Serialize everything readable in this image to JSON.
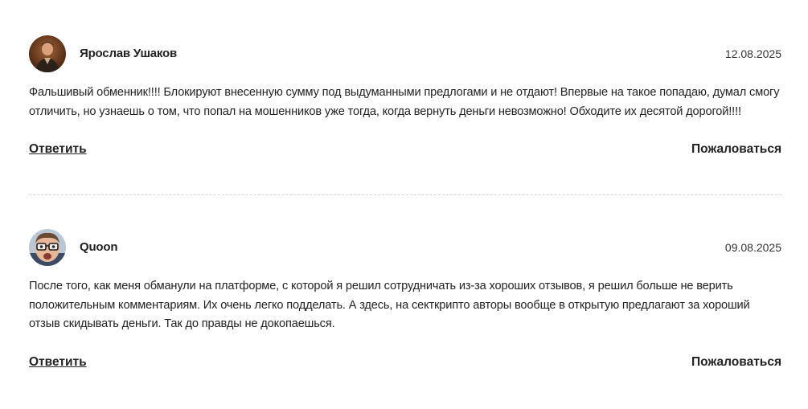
{
  "reviews": [
    {
      "author": "Ярослав Ушаков",
      "date": "12.08.2025",
      "text": "Фальшивый обменник!!!! Блокируют внесенную сумму под выдуманными предлогами и не отдают! Впервые на такое попадаю, думал смогу отличить, но узнаешь о том, что попал на мошенников уже тогда, когда вернуть деньги невозможно! Обходите их десятой дорогой!!!!",
      "reply_label": "Ответить",
      "complain_label": "Пожаловаться",
      "avatar_icon": "user-photo-avatar"
    },
    {
      "author": "Quoon",
      "date": "09.08.2025",
      "text": "После того, как меня обманули на платформе, с которой я решил сотрудничать из-за хороших отзывов, я решил больше не верить положительным комментариям. Их очень легко подделать. А здесь, на секткрипто авторы вообще в открытую предлагают за хороший отзыв скидывать деньги. Так до правды не докопаешься.",
      "reply_label": "Ответить",
      "complain_label": "Пожаловаться",
      "avatar_icon": "user-photo-avatar"
    }
  ]
}
